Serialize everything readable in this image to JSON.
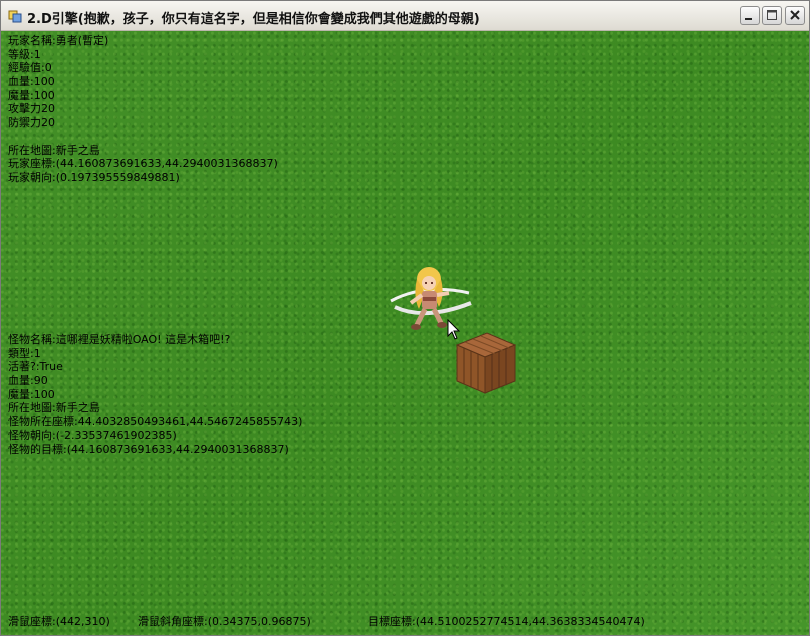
{
  "window": {
    "title": "2.D引擎(抱歉，孩子，你只有這名字，但是相信你會變成我們其他遊戲的母親)"
  },
  "player": {
    "lines": [
      "玩家名稱:勇者(暫定)",
      "等級:1",
      "經驗值:0",
      "血量:100",
      "魔量:100",
      "攻擊力20",
      "防禦力20"
    ],
    "map": "所在地圖:新手之島",
    "position": "玩家座標:(44.160873691633,44.2940031368837)",
    "facing": "玩家朝向:(0.197395559849881)"
  },
  "monster": {
    "lines": [
      "怪物名稱:這哪裡是妖精啦OAO! 這是木箱吧!?",
      "類型:1",
      "活著?:True",
      "血量:90",
      "魔量:100",
      "所在地圖:新手之島",
      "怪物所在座標:44.4032850493461,44.5467245855743)",
      "怪物朝向:(-2.33537461902385)",
      "怪物的目標:(44.160873691633,44.2940031368837)"
    ]
  },
  "status": {
    "mouse": "滑鼠座標:(442,310)",
    "mouse_ratio": "滑鼠斜角座標:(0.34375,0.96875)",
    "target": "目標座標:(44.5100252774514,44.3638334540474)"
  },
  "colors": {
    "grass": "#3f8f24",
    "text": "#000000"
  },
  "icons": {
    "app": "app-icon",
    "minimize": "minimize-icon",
    "maximize": "maximize-icon",
    "close": "close-icon"
  }
}
